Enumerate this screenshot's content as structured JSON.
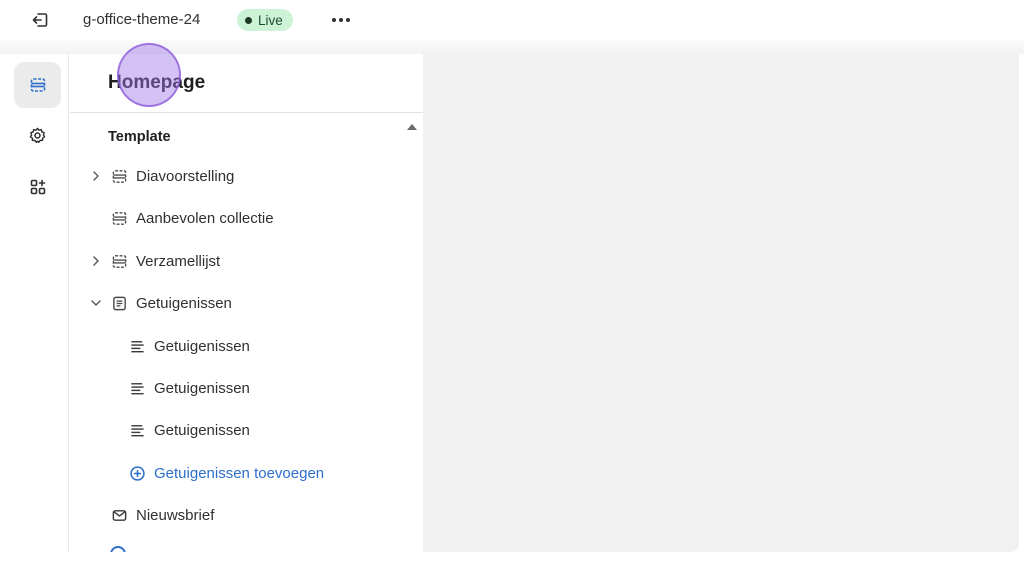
{
  "topbar": {
    "exit_icon": "exit-icon",
    "theme_name": "g-office-theme-24",
    "status_badge": "Live",
    "more_icon": "more-horizontal-icon"
  },
  "rail": {
    "items": [
      {
        "icon": "sections-icon",
        "active": true
      },
      {
        "icon": "gear-icon",
        "active": false
      },
      {
        "icon": "apps-icon",
        "active": false
      }
    ]
  },
  "panel": {
    "title": "Homepage",
    "section_label": "Template",
    "items": [
      {
        "label": "Diavoorstelling",
        "icon": "section-icon",
        "chevron": "right"
      },
      {
        "label": "Aanbevolen collectie",
        "icon": "section-icon",
        "chevron": "none"
      },
      {
        "label": "Verzamellijst",
        "icon": "section-icon",
        "chevron": "right"
      },
      {
        "label": "Getuigenissen",
        "icon": "document-icon",
        "chevron": "down"
      },
      {
        "label": "Getuigenissen",
        "icon": "text-lines-icon",
        "child": true
      },
      {
        "label": "Getuigenissen",
        "icon": "text-lines-icon",
        "child": true
      },
      {
        "label": "Getuigenissen",
        "icon": "text-lines-icon",
        "child": true
      },
      {
        "label": "Getuigenissen toevoegen",
        "icon": "plus-circle-icon",
        "child": true,
        "add": true
      },
      {
        "label": "Nieuwsbrief",
        "icon": "envelope-icon",
        "chevron": "none"
      }
    ]
  },
  "colors": {
    "accent": "#2c6ecb",
    "live_badge_bg": "#cdf3d6",
    "canvas_bg": "#f1f1f1"
  }
}
